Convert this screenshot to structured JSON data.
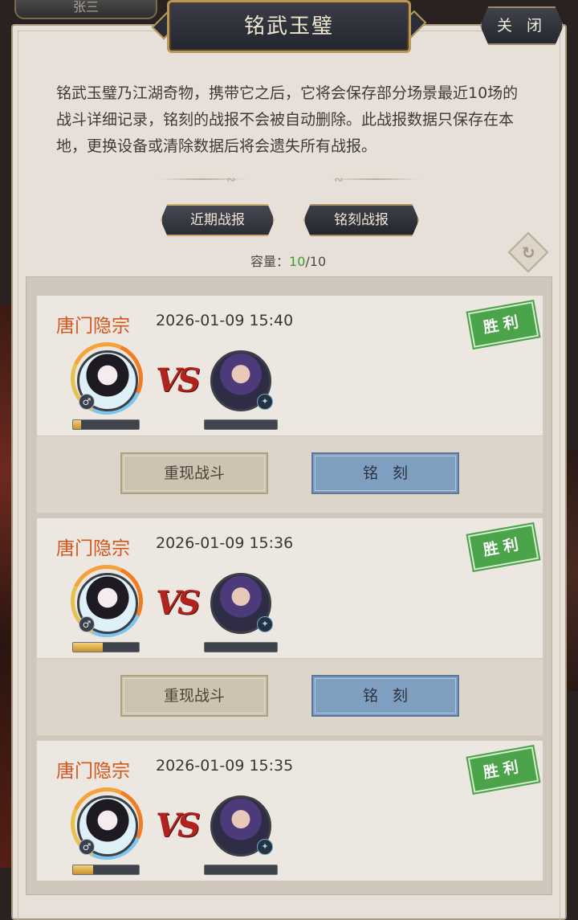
{
  "top_tab": {
    "label": "张三"
  },
  "window": {
    "title": "铭武玉璧",
    "close_label": "关 闭"
  },
  "description": "铭武玉璧乃江湖奇物，携带它之后，它将会保存部分场景最近10场的战斗详细记录，铭刻的战报不会被自动删除。此战报数据只保存在本地，更换设备或清除数据后将会遗失所有战报。",
  "tabs": [
    {
      "label": "近期战报",
      "active": true
    },
    {
      "label": "铭刻战报",
      "active": false
    }
  ],
  "capacity": {
    "label": "容量：",
    "used": "10",
    "total": "/10"
  },
  "colors": {
    "accent_orange": "#d2561c",
    "win_green": "#4ba34a",
    "engrave_blue": "#7f9fc0",
    "used_green": "#3a9c2e"
  },
  "reports": [
    {
      "sect": "唐门隐宗",
      "timestamp": "2026-01-09 15:40",
      "result": "胜利",
      "vs": "VS",
      "left_progress": 0.12,
      "right_progress": 0,
      "replay_label": "重现战斗",
      "engrave_label": "铭刻"
    },
    {
      "sect": "唐门隐宗",
      "timestamp": "2026-01-09 15:36",
      "result": "胜利",
      "vs": "VS",
      "left_progress": 0.45,
      "right_progress": 0,
      "replay_label": "重现战斗",
      "engrave_label": "铭刻"
    },
    {
      "sect": "唐门隐宗",
      "timestamp": "2026-01-09 15:35",
      "result": "胜利",
      "vs": "VS",
      "left_progress": 0.3,
      "right_progress": 0,
      "replay_label": "重现战斗",
      "engrave_label": "铭刻"
    }
  ]
}
